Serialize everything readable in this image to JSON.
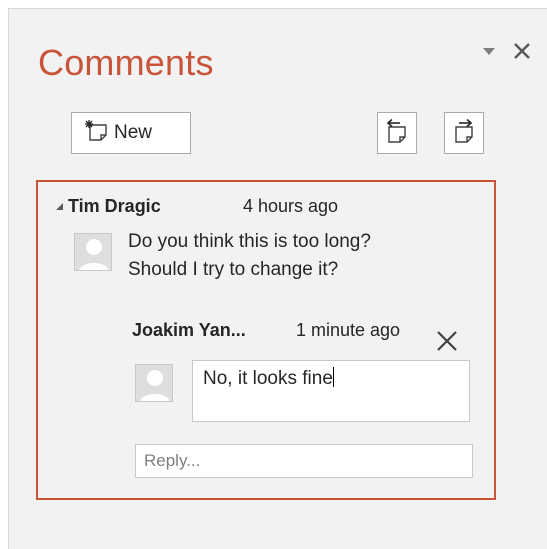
{
  "pane": {
    "title": "Comments",
    "menu_icon": "triangle-down-icon",
    "close_icon": "close-icon"
  },
  "toolbar": {
    "new_label": "New",
    "new_icon": "new-comment-icon",
    "prev_icon": "previous-comment-icon",
    "next_icon": "next-comment-icon"
  },
  "thread": {
    "author": "Tim Dragic",
    "time": "4 hours ago",
    "text_line1": "Do you think this is too long?",
    "text_line2": "Should I try to change it?",
    "reply": {
      "author": "Joakim Yan...",
      "time": "1 minute ago",
      "text": "No, it looks fine"
    },
    "reply_placeholder": "Reply..."
  },
  "colors": {
    "accent": "#c8553a",
    "pane_bg": "#f2f2f2"
  }
}
